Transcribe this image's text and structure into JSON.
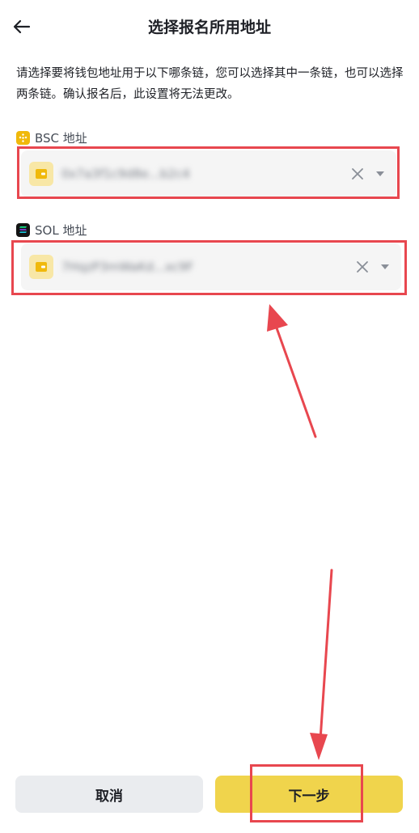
{
  "header": {
    "title": "选择报名所用地址"
  },
  "description": "请选择要将钱包地址用于以下哪条链，您可以选择其中一条链，也可以选择两条链。确认报名后，此设置将无法更改。",
  "bsc": {
    "label": "BSC 地址",
    "address": "0x7a3f1c9d8e...b2c4"
  },
  "sol": {
    "label": "SOL 地址",
    "address": "7HqzP3mWaKd...xc9F"
  },
  "footer": {
    "cancel_label": "取消",
    "next_label": "下一步"
  },
  "colors": {
    "accent": "#f0d44c",
    "highlight": "#e8474f",
    "bsc_brand": "#f0b90b",
    "sol_brand": "#141414"
  }
}
